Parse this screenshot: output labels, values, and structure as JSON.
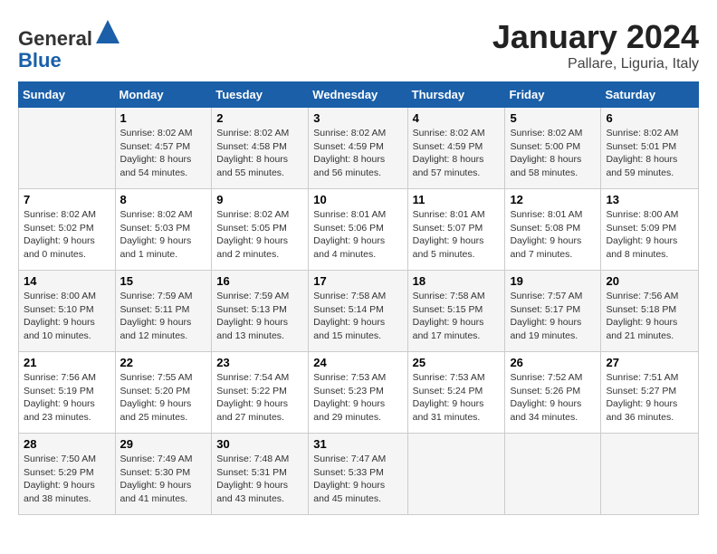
{
  "header": {
    "logo_general": "General",
    "logo_blue": "Blue",
    "month": "January 2024",
    "location": "Pallare, Liguria, Italy"
  },
  "days_of_week": [
    "Sunday",
    "Monday",
    "Tuesday",
    "Wednesday",
    "Thursday",
    "Friday",
    "Saturday"
  ],
  "weeks": [
    [
      {
        "day": "",
        "info": ""
      },
      {
        "day": "1",
        "info": "Sunrise: 8:02 AM\nSunset: 4:57 PM\nDaylight: 8 hours\nand 54 minutes."
      },
      {
        "day": "2",
        "info": "Sunrise: 8:02 AM\nSunset: 4:58 PM\nDaylight: 8 hours\nand 55 minutes."
      },
      {
        "day": "3",
        "info": "Sunrise: 8:02 AM\nSunset: 4:59 PM\nDaylight: 8 hours\nand 56 minutes."
      },
      {
        "day": "4",
        "info": "Sunrise: 8:02 AM\nSunset: 4:59 PM\nDaylight: 8 hours\nand 57 minutes."
      },
      {
        "day": "5",
        "info": "Sunrise: 8:02 AM\nSunset: 5:00 PM\nDaylight: 8 hours\nand 58 minutes."
      },
      {
        "day": "6",
        "info": "Sunrise: 8:02 AM\nSunset: 5:01 PM\nDaylight: 8 hours\nand 59 minutes."
      }
    ],
    [
      {
        "day": "7",
        "info": "Sunrise: 8:02 AM\nSunset: 5:02 PM\nDaylight: 9 hours\nand 0 minutes."
      },
      {
        "day": "8",
        "info": "Sunrise: 8:02 AM\nSunset: 5:03 PM\nDaylight: 9 hours\nand 1 minute."
      },
      {
        "day": "9",
        "info": "Sunrise: 8:02 AM\nSunset: 5:05 PM\nDaylight: 9 hours\nand 2 minutes."
      },
      {
        "day": "10",
        "info": "Sunrise: 8:01 AM\nSunset: 5:06 PM\nDaylight: 9 hours\nand 4 minutes."
      },
      {
        "day": "11",
        "info": "Sunrise: 8:01 AM\nSunset: 5:07 PM\nDaylight: 9 hours\nand 5 minutes."
      },
      {
        "day": "12",
        "info": "Sunrise: 8:01 AM\nSunset: 5:08 PM\nDaylight: 9 hours\nand 7 minutes."
      },
      {
        "day": "13",
        "info": "Sunrise: 8:00 AM\nSunset: 5:09 PM\nDaylight: 9 hours\nand 8 minutes."
      }
    ],
    [
      {
        "day": "14",
        "info": "Sunrise: 8:00 AM\nSunset: 5:10 PM\nDaylight: 9 hours\nand 10 minutes."
      },
      {
        "day": "15",
        "info": "Sunrise: 7:59 AM\nSunset: 5:11 PM\nDaylight: 9 hours\nand 12 minutes."
      },
      {
        "day": "16",
        "info": "Sunrise: 7:59 AM\nSunset: 5:13 PM\nDaylight: 9 hours\nand 13 minutes."
      },
      {
        "day": "17",
        "info": "Sunrise: 7:58 AM\nSunset: 5:14 PM\nDaylight: 9 hours\nand 15 minutes."
      },
      {
        "day": "18",
        "info": "Sunrise: 7:58 AM\nSunset: 5:15 PM\nDaylight: 9 hours\nand 17 minutes."
      },
      {
        "day": "19",
        "info": "Sunrise: 7:57 AM\nSunset: 5:17 PM\nDaylight: 9 hours\nand 19 minutes."
      },
      {
        "day": "20",
        "info": "Sunrise: 7:56 AM\nSunset: 5:18 PM\nDaylight: 9 hours\nand 21 minutes."
      }
    ],
    [
      {
        "day": "21",
        "info": "Sunrise: 7:56 AM\nSunset: 5:19 PM\nDaylight: 9 hours\nand 23 minutes."
      },
      {
        "day": "22",
        "info": "Sunrise: 7:55 AM\nSunset: 5:20 PM\nDaylight: 9 hours\nand 25 minutes."
      },
      {
        "day": "23",
        "info": "Sunrise: 7:54 AM\nSunset: 5:22 PM\nDaylight: 9 hours\nand 27 minutes."
      },
      {
        "day": "24",
        "info": "Sunrise: 7:53 AM\nSunset: 5:23 PM\nDaylight: 9 hours\nand 29 minutes."
      },
      {
        "day": "25",
        "info": "Sunrise: 7:53 AM\nSunset: 5:24 PM\nDaylight: 9 hours\nand 31 minutes."
      },
      {
        "day": "26",
        "info": "Sunrise: 7:52 AM\nSunset: 5:26 PM\nDaylight: 9 hours\nand 34 minutes."
      },
      {
        "day": "27",
        "info": "Sunrise: 7:51 AM\nSunset: 5:27 PM\nDaylight: 9 hours\nand 36 minutes."
      }
    ],
    [
      {
        "day": "28",
        "info": "Sunrise: 7:50 AM\nSunset: 5:29 PM\nDaylight: 9 hours\nand 38 minutes."
      },
      {
        "day": "29",
        "info": "Sunrise: 7:49 AM\nSunset: 5:30 PM\nDaylight: 9 hours\nand 41 minutes."
      },
      {
        "day": "30",
        "info": "Sunrise: 7:48 AM\nSunset: 5:31 PM\nDaylight: 9 hours\nand 43 minutes."
      },
      {
        "day": "31",
        "info": "Sunrise: 7:47 AM\nSunset: 5:33 PM\nDaylight: 9 hours\nand 45 minutes."
      },
      {
        "day": "",
        "info": ""
      },
      {
        "day": "",
        "info": ""
      },
      {
        "day": "",
        "info": ""
      }
    ]
  ]
}
